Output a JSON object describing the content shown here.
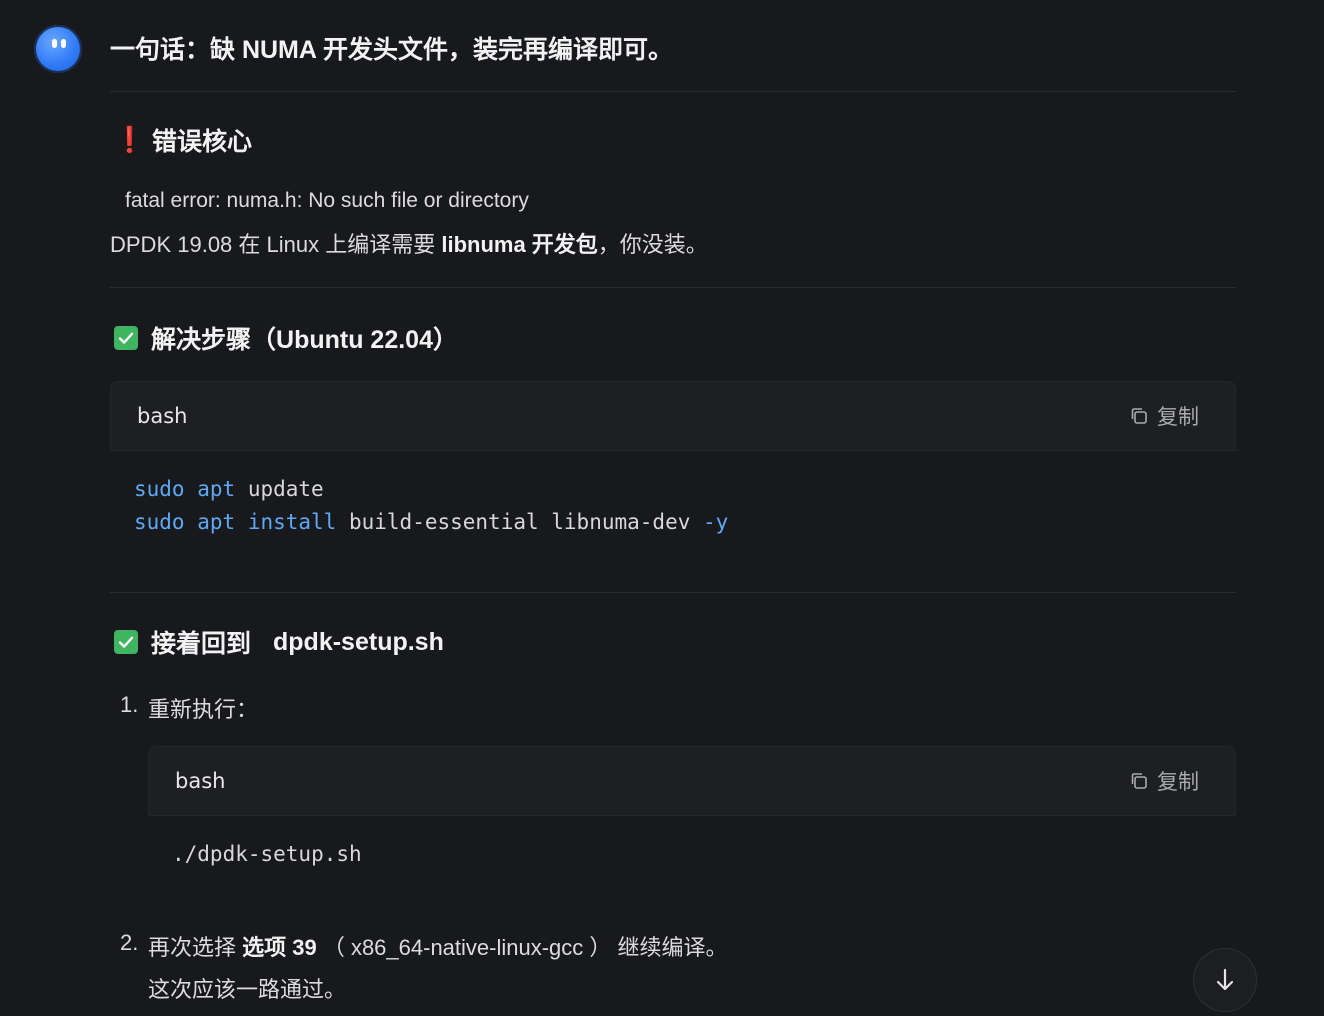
{
  "message": {
    "headline": "一句话：缺 NUMA 开发头文件，装完再编译即可。",
    "error_section": {
      "icon": "exclamation-icon",
      "title": "错误核心",
      "error_line": "fatal error: numa.h: No such file or directory",
      "explain_prefix": "DPDK 19.08 在 Linux 上编译需要 ",
      "explain_bold": "libnuma 开发包",
      "explain_suffix": "，你没装。"
    },
    "steps_section": {
      "icon": "check-icon",
      "title": "解决步骤",
      "title_suffix": "（Ubuntu 22.04）",
      "code": {
        "lang": "bash",
        "copy_label": "复制",
        "lines": [
          {
            "cmd1": "sudo",
            "cmd2": "apt",
            "cmd3": "",
            "rest": " update",
            "flag": ""
          },
          {
            "cmd1": "sudo",
            "cmd2": "apt",
            "cmd3": "install",
            "rest": " build-essential libnuma-dev ",
            "flag": "-y"
          }
        ]
      }
    },
    "next_section": {
      "icon": "check-icon",
      "title": "接着回到",
      "title_suffix": "dpdk-setup.sh",
      "item1": {
        "num": "1.",
        "text": "重新执行：",
        "code": {
          "lang": "bash",
          "copy_label": "复制",
          "line": "./dpdk-setup.sh"
        }
      },
      "item2": {
        "num": "2.",
        "text_prefix": "再次选择 ",
        "text_bold": "选项 39",
        "text_mid": " （ x86_64-native-linux-gcc ） 继续编译。",
        "text_line2": "这次应该一路通过。"
      }
    }
  },
  "scroll_button": {
    "icon": "arrow-down-icon"
  }
}
